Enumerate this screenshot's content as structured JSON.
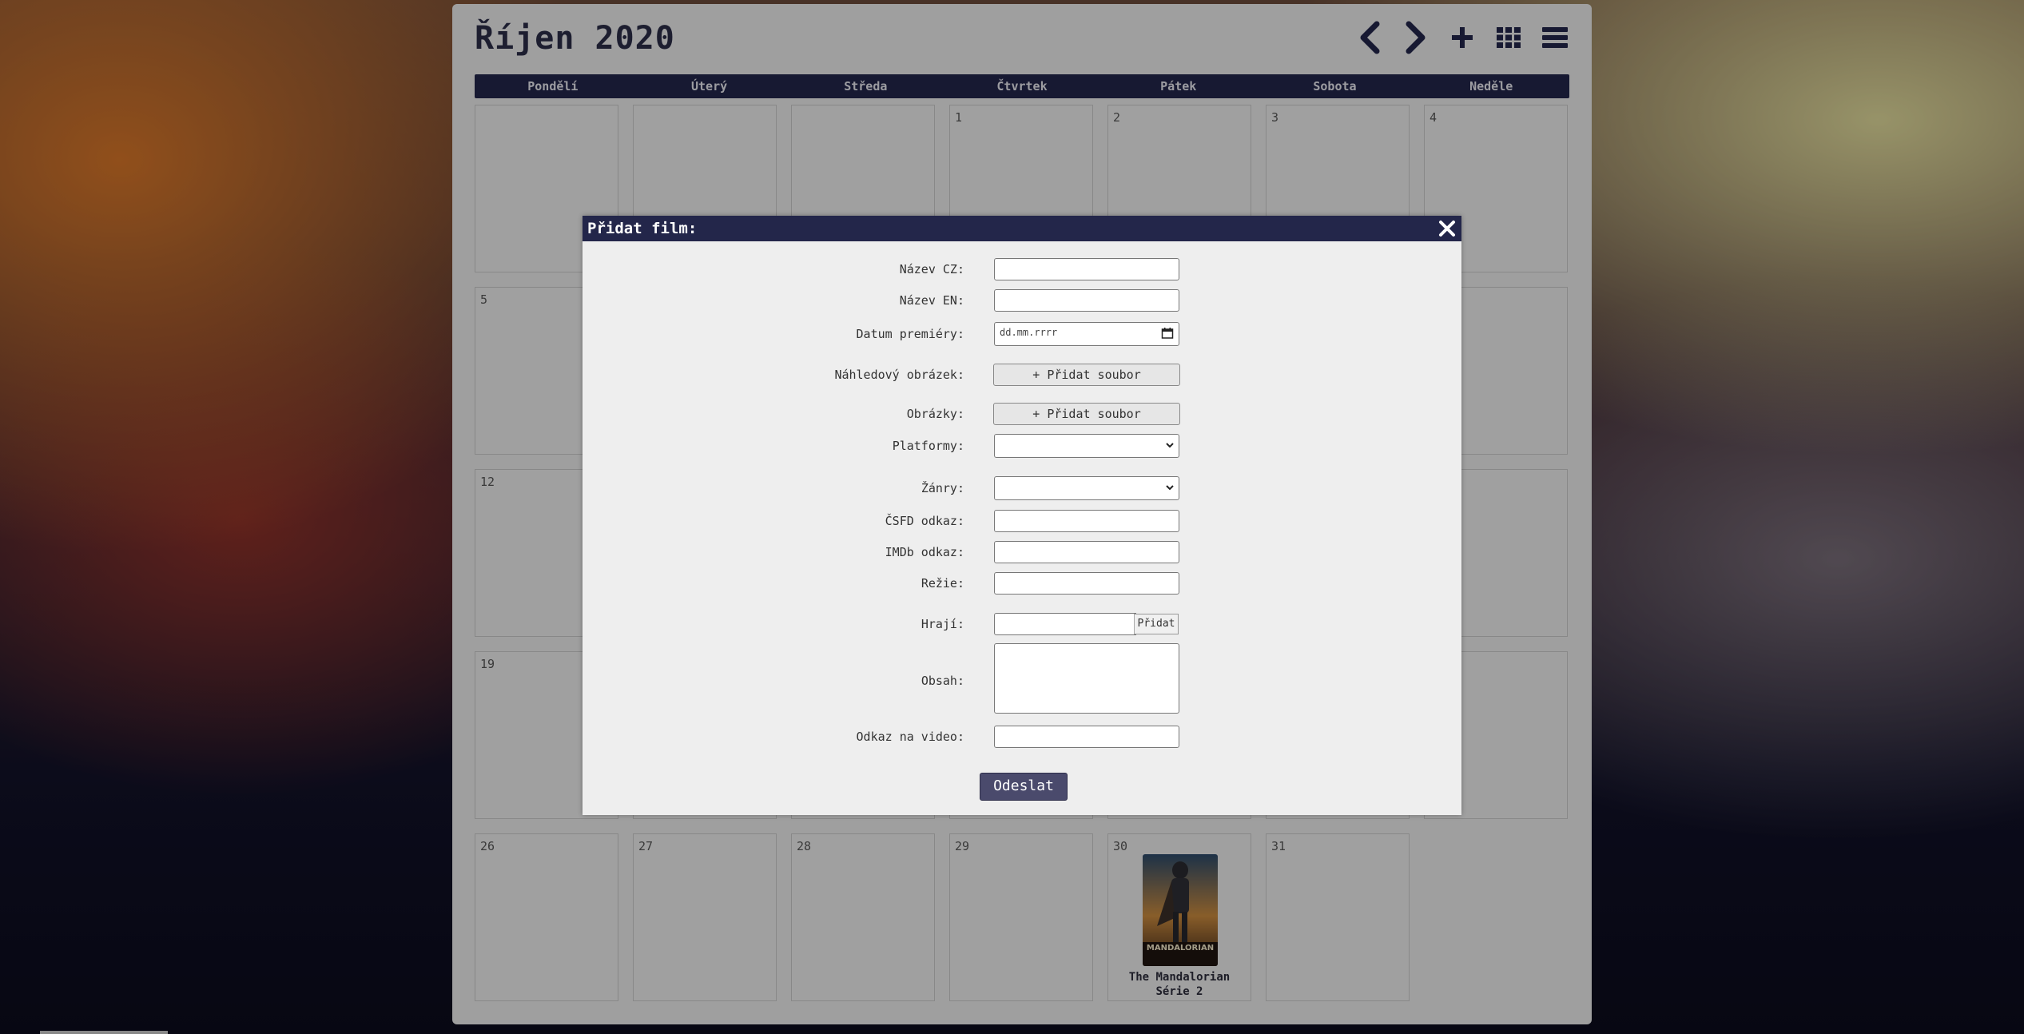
{
  "calendar": {
    "title": "Říjen 2020",
    "weekdays": [
      "Pondělí",
      "Úterý",
      "Středa",
      "Čtvrtek",
      "Pátek",
      "Sobota",
      "Neděle"
    ],
    "days": [
      "1",
      "2",
      "3",
      "4",
      "5",
      "12",
      "19",
      "26",
      "27",
      "28",
      "29",
      "30",
      "31"
    ],
    "film": {
      "title_line1": "The Mandalorian",
      "title_line2": "Série 2",
      "poster_text": "MANDALORIAN"
    }
  },
  "toolbar": {
    "icons": [
      "chevron-left-icon",
      "chevron-right-icon",
      "plus-icon",
      "grid-icon",
      "list-icon"
    ]
  },
  "modal": {
    "title": "Přidat film:",
    "labels": {
      "name_cz": "Název CZ:",
      "name_en": "Název EN:",
      "premiere": "Datum premiéry:",
      "preview": "Náhledový obrázek:",
      "images": "Obrázky:",
      "platforms": "Platformy:",
      "genres": "Žánry:",
      "csfd": "ČSFD odkaz:",
      "imdb": "IMDb odkaz:",
      "director": "Režie:",
      "cast": "Hrají:",
      "content": "Obsah:",
      "video": "Odkaz na video:"
    },
    "date_placeholder": "dd.mm.rrrr",
    "file_button": "+ Přidat soubor",
    "add_button": "Přidat",
    "submit": "Odeslat"
  },
  "colors": {
    "header_bg": "#23264a",
    "submit_bg": "#4a4a6c",
    "panel_bg": "#ebebeb"
  }
}
